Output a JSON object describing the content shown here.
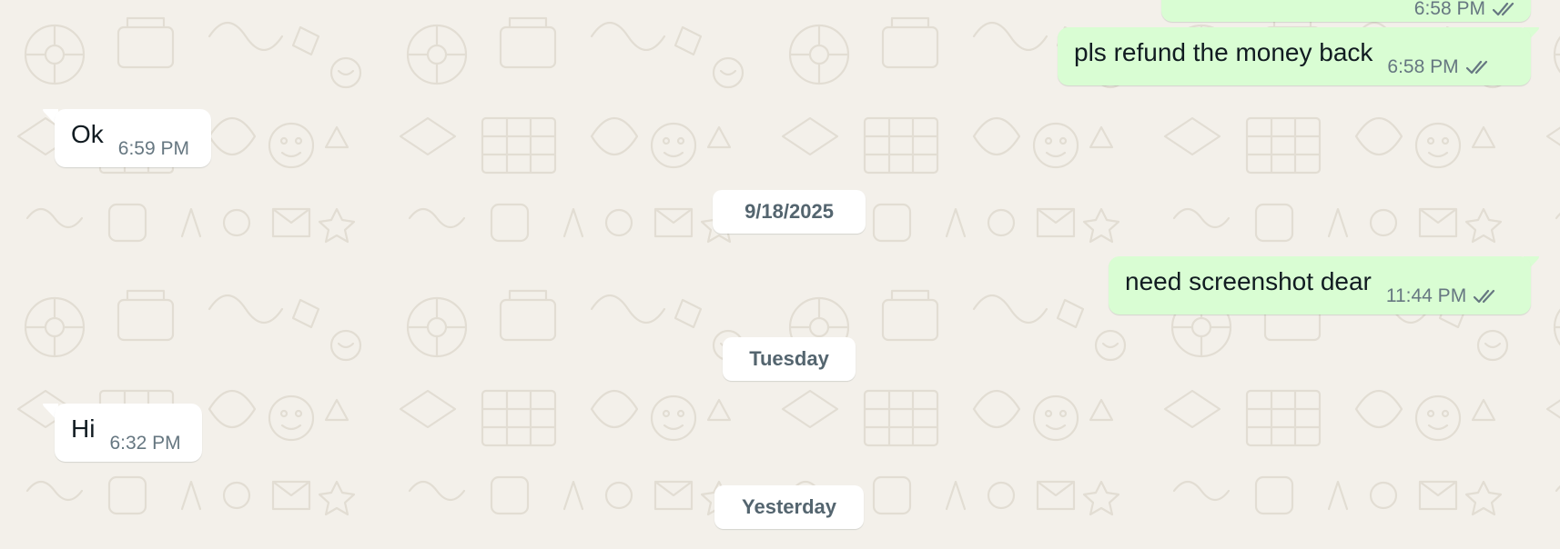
{
  "chat": {
    "messages": [
      {
        "direction": "out",
        "text": "",
        "time": "6:58 PM",
        "status_icon": "double-check-icon"
      },
      {
        "direction": "out",
        "text": "pls refund the money back",
        "time": "6:58 PM",
        "status_icon": "double-check-icon"
      },
      {
        "direction": "in",
        "text": "Ok",
        "time": "6:59 PM"
      },
      {
        "direction": "out",
        "text": "need screenshot dear",
        "time": "11:44 PM",
        "status_icon": "double-check-icon"
      },
      {
        "direction": "in",
        "text": "Hi",
        "time": "6:32 PM"
      }
    ],
    "date_separators": [
      "9/18/2025",
      "Tuesday",
      "Yesterday"
    ]
  },
  "colors": {
    "background": "#f3f0ea",
    "outgoing_bubble": "#d9fdd3",
    "incoming_bubble": "#ffffff",
    "timestamp": "#667781",
    "read_check": "#667781",
    "date_chip_text": "#54656f"
  }
}
